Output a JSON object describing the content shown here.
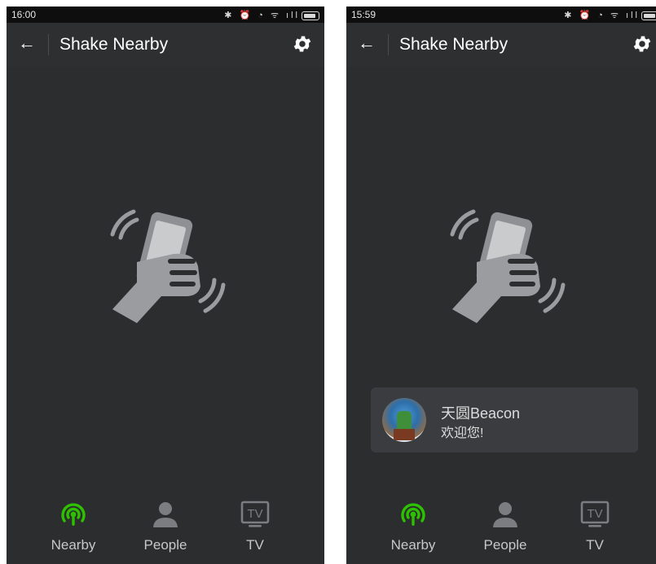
{
  "screens": [
    {
      "status_time": "16:00",
      "title": "Shake Nearby",
      "tabs": [
        "Nearby",
        "People",
        "TV"
      ]
    },
    {
      "status_time": "15:59",
      "title": "Shake Nearby",
      "notification": {
        "title": "天圆Beacon",
        "subtitle": "欢迎您!"
      },
      "tabs": [
        "Nearby",
        "People",
        "TV"
      ]
    }
  ],
  "tv_icon_text": "TV",
  "colors": {
    "background": "#2b2d2f",
    "status_bar": "#0e0e0e",
    "active_tab": "#2dc100",
    "inactive_icon": "#7b7d80",
    "notification_bg": "#3a3c3f"
  }
}
